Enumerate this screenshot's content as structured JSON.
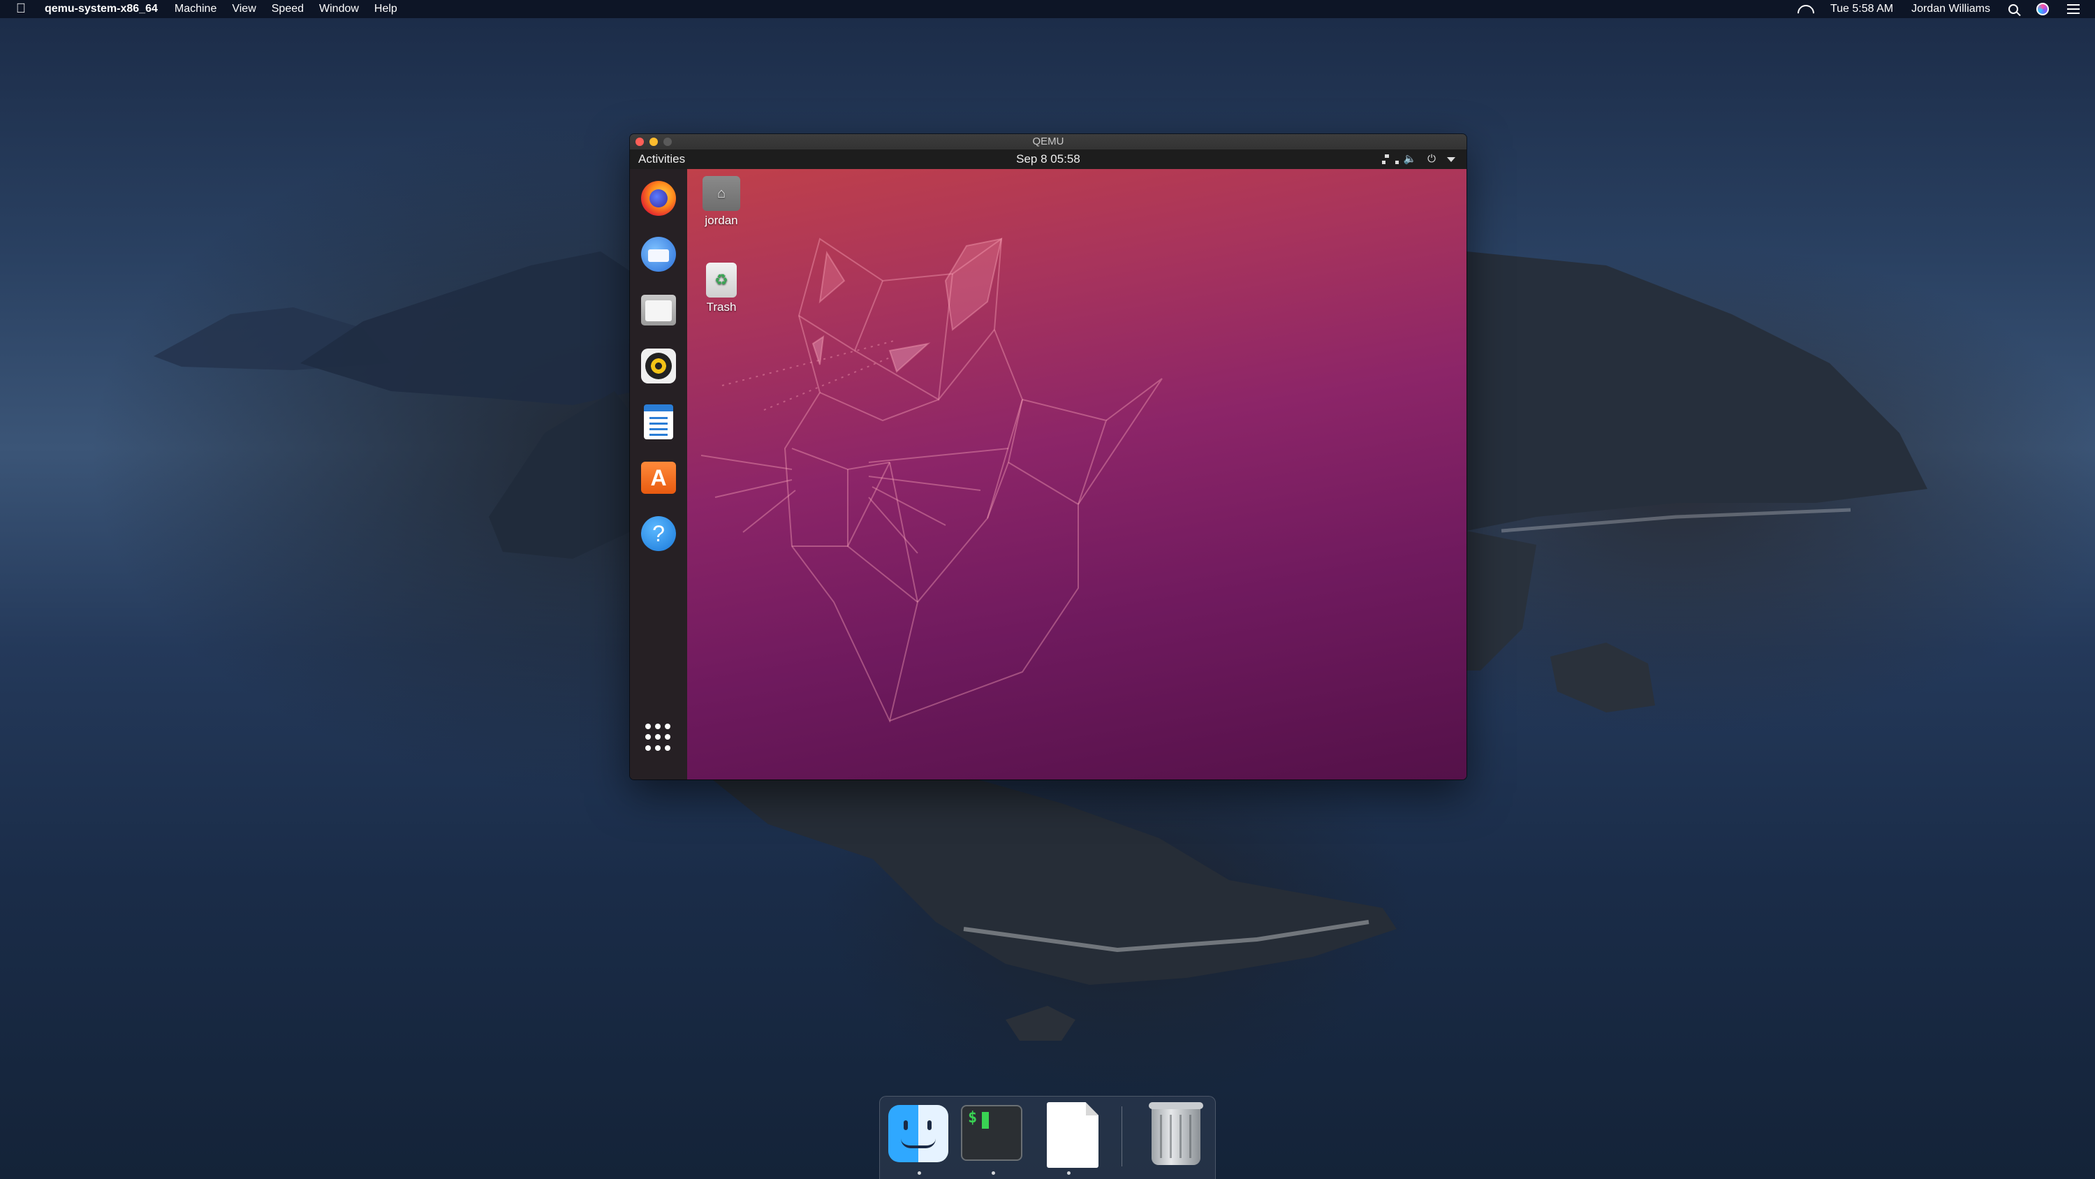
{
  "mac_menubar": {
    "app_name": "qemu-system-x86_64",
    "menus": [
      "Machine",
      "View",
      "Speed",
      "Window",
      "Help"
    ],
    "clock": "Tue 5:58 AM",
    "user": "Jordan Williams"
  },
  "qemu_window": {
    "title": "QEMU"
  },
  "ubuntu": {
    "topbar": {
      "activities_label": "Activities",
      "clock": "Sep 8  05:58"
    },
    "desktop_icons": [
      {
        "label": "jordan"
      },
      {
        "label": "Trash"
      }
    ],
    "dock_apps": [
      "firefox-icon",
      "thunderbird-icon",
      "files-icon",
      "rhythmbox-icon",
      "libreoffice-writer-icon",
      "ubuntu-software-icon",
      "help-icon"
    ]
  },
  "mac_dock": {
    "apps": [
      "finder-icon",
      "terminal-icon",
      "document-icon",
      "trash-icon"
    ],
    "terminal_prompt": "$"
  },
  "colors": {
    "ubuntu_gradient_top": "#c0404a",
    "ubuntu_gradient_bottom": "#541149",
    "gnome_topbar": "#1d1d1d",
    "ubuntu_dock": "#262024"
  }
}
